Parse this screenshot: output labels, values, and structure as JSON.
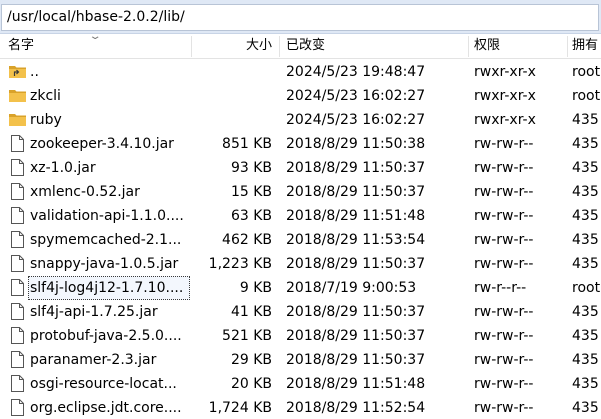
{
  "path": "/usr/local/hbase-2.0.2/lib/",
  "columns": {
    "name": "名字",
    "size": "大小",
    "modified": "已改变",
    "permissions": "权限",
    "owner": "拥有"
  },
  "files": [
    {
      "name": "..",
      "size": "",
      "modified": "2024/5/23 19:48:47",
      "permissions": "rwxr-xr-x",
      "owner": "root",
      "icon": "parent-folder-icon"
    },
    {
      "name": "zkcli",
      "size": "",
      "modified": "2024/5/23 16:02:27",
      "permissions": "rwxr-xr-x",
      "owner": "root",
      "icon": "folder-icon"
    },
    {
      "name": "ruby",
      "size": "",
      "modified": "2024/5/23 16:02:27",
      "permissions": "rwxr-xr-x",
      "owner": "435",
      "icon": "folder-icon"
    },
    {
      "name": "zookeeper-3.4.10.jar",
      "size": "851 KB",
      "modified": "2018/8/29 11:50:38",
      "permissions": "rw-rw-r--",
      "owner": "435",
      "icon": "file-icon"
    },
    {
      "name": "xz-1.0.jar",
      "size": "93 KB",
      "modified": "2018/8/29 11:50:37",
      "permissions": "rw-rw-r--",
      "owner": "435",
      "icon": "file-icon"
    },
    {
      "name": "xmlenc-0.52.jar",
      "size": "15 KB",
      "modified": "2018/8/29 11:50:37",
      "permissions": "rw-rw-r--",
      "owner": "435",
      "icon": "file-icon"
    },
    {
      "name": "validation-api-1.1.0....",
      "size": "63 KB",
      "modified": "2018/8/29 11:51:48",
      "permissions": "rw-rw-r--",
      "owner": "435",
      "icon": "file-icon"
    },
    {
      "name": "spymemcached-2.1...",
      "size": "462 KB",
      "modified": "2018/8/29 11:53:54",
      "permissions": "rw-rw-r--",
      "owner": "435",
      "icon": "file-icon"
    },
    {
      "name": "snappy-java-1.0.5.jar",
      "size": "1,223 KB",
      "modified": "2018/8/29 11:50:37",
      "permissions": "rw-rw-r--",
      "owner": "435",
      "icon": "file-icon"
    },
    {
      "name": "slf4j-log4j12-1.7.10....",
      "size": "9 KB",
      "modified": "2018/7/19 9:00:53",
      "permissions": "rw-r--r--",
      "owner": "root",
      "icon": "file-icon",
      "selected": true
    },
    {
      "name": "slf4j-api-1.7.25.jar",
      "size": "41 KB",
      "modified": "2018/8/29 11:50:37",
      "permissions": "rw-rw-r--",
      "owner": "435",
      "icon": "file-icon"
    },
    {
      "name": "protobuf-java-2.5.0....",
      "size": "521 KB",
      "modified": "2018/8/29 11:50:37",
      "permissions": "rw-rw-r--",
      "owner": "435",
      "icon": "file-icon"
    },
    {
      "name": "paranamer-2.3.jar",
      "size": "29 KB",
      "modified": "2018/8/29 11:50:37",
      "permissions": "rw-rw-r--",
      "owner": "435",
      "icon": "file-icon"
    },
    {
      "name": "osgi-resource-locat...",
      "size": "20 KB",
      "modified": "2018/8/29 11:51:48",
      "permissions": "rw-rw-r--",
      "owner": "435",
      "icon": "file-icon"
    },
    {
      "name": "org.eclipse.jdt.core....",
      "size": "1,724 KB",
      "modified": "2018/8/29 11:52:54",
      "permissions": "rw-rw-r--",
      "owner": "435",
      "icon": "file-icon"
    }
  ],
  "colors": {
    "folder": "#f3c14b",
    "folder_dark": "#d9a22a",
    "header_bg": "#dfe8f5"
  }
}
